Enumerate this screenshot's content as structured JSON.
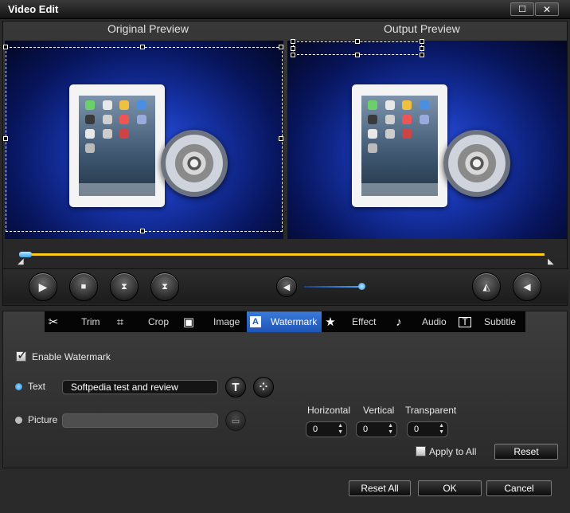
{
  "window": {
    "title": "Video Edit",
    "maximize_glyph": "☐",
    "close_glyph": "✕"
  },
  "preview": {
    "original_label": "Original Preview",
    "output_label": "Output Preview"
  },
  "playback": {
    "volume_level": 0.92,
    "timeline_position": 0.0
  },
  "tabs": [
    {
      "label": "Trim",
      "icon": "scissors-icon"
    },
    {
      "label": "Crop",
      "icon": "crop-icon"
    },
    {
      "label": "Image",
      "icon": "image-icon"
    },
    {
      "label": "Watermark",
      "icon": "watermark-icon",
      "active": true
    },
    {
      "label": "Effect",
      "icon": "star-icon"
    },
    {
      "label": "Audio",
      "icon": "music-note-icon"
    },
    {
      "label": "Subtitle",
      "icon": "subtitle-icon"
    }
  ],
  "watermark": {
    "enable_label": "Enable Watermark",
    "enabled": true,
    "text_label": "Text",
    "text_value": "Softpedia test and review",
    "picture_label": "Picture",
    "text_style_glyph": "T",
    "position": {
      "horizontal_label": "Horizontal",
      "horizontal_value": "0",
      "vertical_label": "Vertical",
      "vertical_value": "0",
      "transparent_label": "Transparent",
      "transparent_value": "0"
    },
    "apply_to_all_label": "Apply to All",
    "reset_label": "Reset"
  },
  "footer": {
    "reset_all_label": "Reset All",
    "ok_label": "OK",
    "cancel_label": "Cancel"
  },
  "colors": {
    "accent_blue": "#2a6bd0",
    "timeline_yellow": "#ffcc1a",
    "background": "#2a2a2a"
  }
}
